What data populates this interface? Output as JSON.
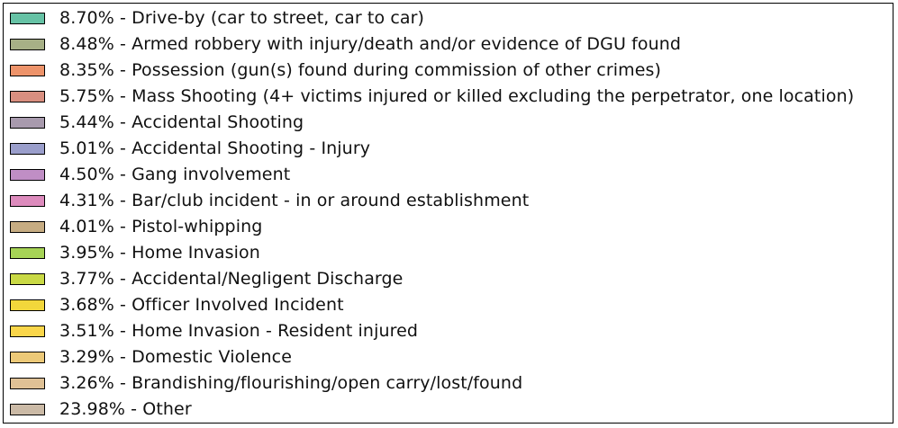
{
  "chart_data": {
    "type": "pie",
    "legend_placement": "full-frame",
    "title": "",
    "series": [
      {
        "values": [
          8.7,
          8.48,
          8.35,
          5.75,
          5.44,
          5.01,
          4.5,
          4.31,
          4.01,
          3.95,
          3.77,
          3.68,
          3.51,
          3.29,
          3.26,
          23.98
        ]
      }
    ],
    "slices": [
      {
        "label": "8.70% - Drive-by (car to street, car to car)",
        "value": 8.7,
        "color": "#66c2a5"
      },
      {
        "label": "8.48% - Armed robbery with injury/death and/or evidence of DGU found",
        "value": 8.48,
        "color": "#a7b086"
      },
      {
        "label": "8.35% - Possession (gun(s) found during commission of other crimes)",
        "value": 8.35,
        "color": "#ed936a"
      },
      {
        "label": "5.75% - Mass Shooting (4+ victims injured or killed excluding the perpetrator, one location)",
        "value": 5.75,
        "color": "#d98f80"
      },
      {
        "label": "5.44% - Accidental Shooting",
        "value": 5.44,
        "color": "#a89aad"
      },
      {
        "label": "5.01% - Accidental Shooting - Injury",
        "value": 5.01,
        "color": "#9a9ecb"
      },
      {
        "label": "4.50% - Gang involvement",
        "value": 4.5,
        "color": "#c08ec5"
      },
      {
        "label": "4.31% - Bar/club incident - in or around establishment",
        "value": 4.31,
        "color": "#dd8bbd"
      },
      {
        "label": "4.01% - Pistol-whipping",
        "value": 4.01,
        "color": "#c6ac82"
      },
      {
        "label": "3.95% - Home Invasion",
        "value": 3.95,
        "color": "#a6d356"
      },
      {
        "label": "3.77% - Accidental/Negligent Discharge",
        "value": 3.77,
        "color": "#c9d945"
      },
      {
        "label": "3.68% - Officer Involved Incident",
        "value": 3.68,
        "color": "#f2d73b"
      },
      {
        "label": "3.51% - Home Invasion - Resident injured",
        "value": 3.51,
        "color": "#fad64a"
      },
      {
        "label": "3.29% - Domestic Violence",
        "value": 3.29,
        "color": "#ecc978"
      },
      {
        "label": "3.26% - Brandishing/flourishing/open carry/lost/found",
        "value": 3.26,
        "color": "#dfc195"
      },
      {
        "label": "23.98% - Other",
        "value": 23.98,
        "color": "#cbbaa6"
      }
    ]
  }
}
